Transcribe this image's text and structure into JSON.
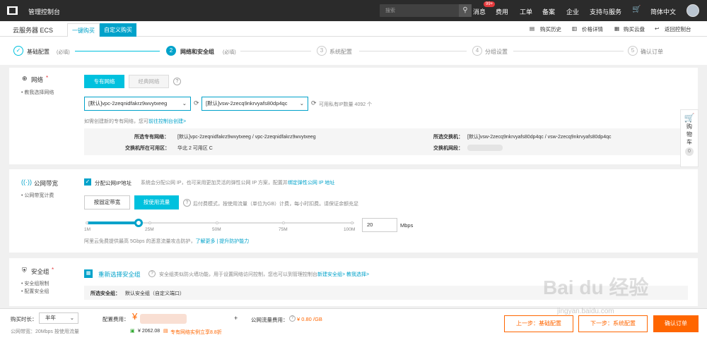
{
  "topbar": {
    "title": "管理控制台",
    "search_placeholder": "搜索",
    "messages": "消息",
    "messages_badge": "99+",
    "billing": "费用",
    "tickets": "工单",
    "filing": "备案",
    "enterprise": "企业",
    "support": "支持与服务",
    "language": "简体中文"
  },
  "subbar": {
    "brand": "云服务器 ECS",
    "tab_quick": "一键购买",
    "tab_custom": "自定义购买",
    "history": "购买历史",
    "price": "价格详情",
    "buy_disk": "购买云盘",
    "back": "返回控制台"
  },
  "steps": [
    {
      "num": "✓",
      "label": "基础配置",
      "note": "(必填)"
    },
    {
      "num": "2",
      "label": "网络和安全组",
      "note": "(必填)"
    },
    {
      "num": "3",
      "label": "系统配置"
    },
    {
      "num": "4",
      "label": "分组设置"
    },
    {
      "num": "5",
      "label": "确认订单"
    }
  ],
  "network": {
    "label": "网络",
    "req": "*",
    "tip": "教我选择网络",
    "btn_vpc": "专有网络",
    "btn_classic": "经典网络",
    "help": "?",
    "vpc_select": "[默认]vpc-2zeqnidfakrz9wvytxeeg",
    "vsw_select": "[默认]vsw-2zecq9nkrvyafs80dp4qc",
    "ip_count_text": "可用私有IP数量 4092 个",
    "create_hint": "如需创建新的专有网络，您可",
    "create_link": "前往控制台创建>",
    "sel_vpc_label": "所选专有网络：",
    "sel_vpc_value": "[默认]vpc-2zeqnidfakrz9wvytxeeg / vpc-2zeqnidfakrz9wvytxeeg",
    "zone_label": "交换机所在可用区：",
    "zone_value": "华北 2 可用区 C",
    "sel_vsw_label": "所选交换机：",
    "sel_vsw_value": "[默认]vsw-2zecq9nkrvyafs80dp4qc / vsw-2zecq9nkrvyafs80dp4qc",
    "vsw_seg_label": "交换机网段："
  },
  "bandwidth": {
    "label": "公网带宽",
    "tip": "公网带宽计费",
    "assign_ip": "分配公网IP地址",
    "assign_desc": "系统会分配公网 IP，也可采用更加灵活的弹性公网 IP 方案，配置并",
    "eip_link": "绑定弹性公网 IP 地址",
    "btn_fixed": "按固定带宽",
    "btn_traffic": "按使用流量",
    "traffic_desc": "后付费模式，按使用流量（单位为GB）计费，每小时扣费。请保证余额充足",
    "ticks": [
      "1M",
      "25M",
      "50M",
      "75M",
      "100M"
    ],
    "value": "20",
    "unit": "Mbps",
    "slider_fraction": 0.19,
    "ddos_text": "阿里云免费提供最高 5Gbps 的恶意流量攻击防护，",
    "learn_more": "了解更多",
    "sep": "|",
    "improve": "提升防护能力"
  },
  "security": {
    "label": "安全组",
    "req": "*",
    "tip1": "安全组限制",
    "tip2": "配置安全组",
    "reselect": "重新选择安全组",
    "desc": "安全组类似防火墙功能，用于设置网络访问控制，您也可以到管理控制台",
    "new_link": "新建安全组>",
    "teach_link": "教我选择>",
    "selected_label": "所选安全组：",
    "selected_value": "默认安全组（自定义端口）"
  },
  "footer": {
    "duration_label": "购买时长：",
    "duration_value": "半年",
    "bandwidth_summary": "公网带宽：20Mbps 按使用流量",
    "cost_label": "配置费用：",
    "plus": "+",
    "traffic_cost_label": "公网流量费用：",
    "traffic_cost_value": "¥ 0.80 /GB",
    "saving": "¥ 2062.08",
    "promo": "专有网络实例立享8.8折",
    "prev": "上一步：基础配置",
    "next": "下一步：系统配置",
    "confirm": "确认订单"
  },
  "cart": {
    "label1": "购",
    "label2": "物",
    "label3": "车",
    "count": "0"
  },
  "watermark": {
    "main": "Bai du 经验",
    "sub": "jingyan.baidu.com"
  }
}
